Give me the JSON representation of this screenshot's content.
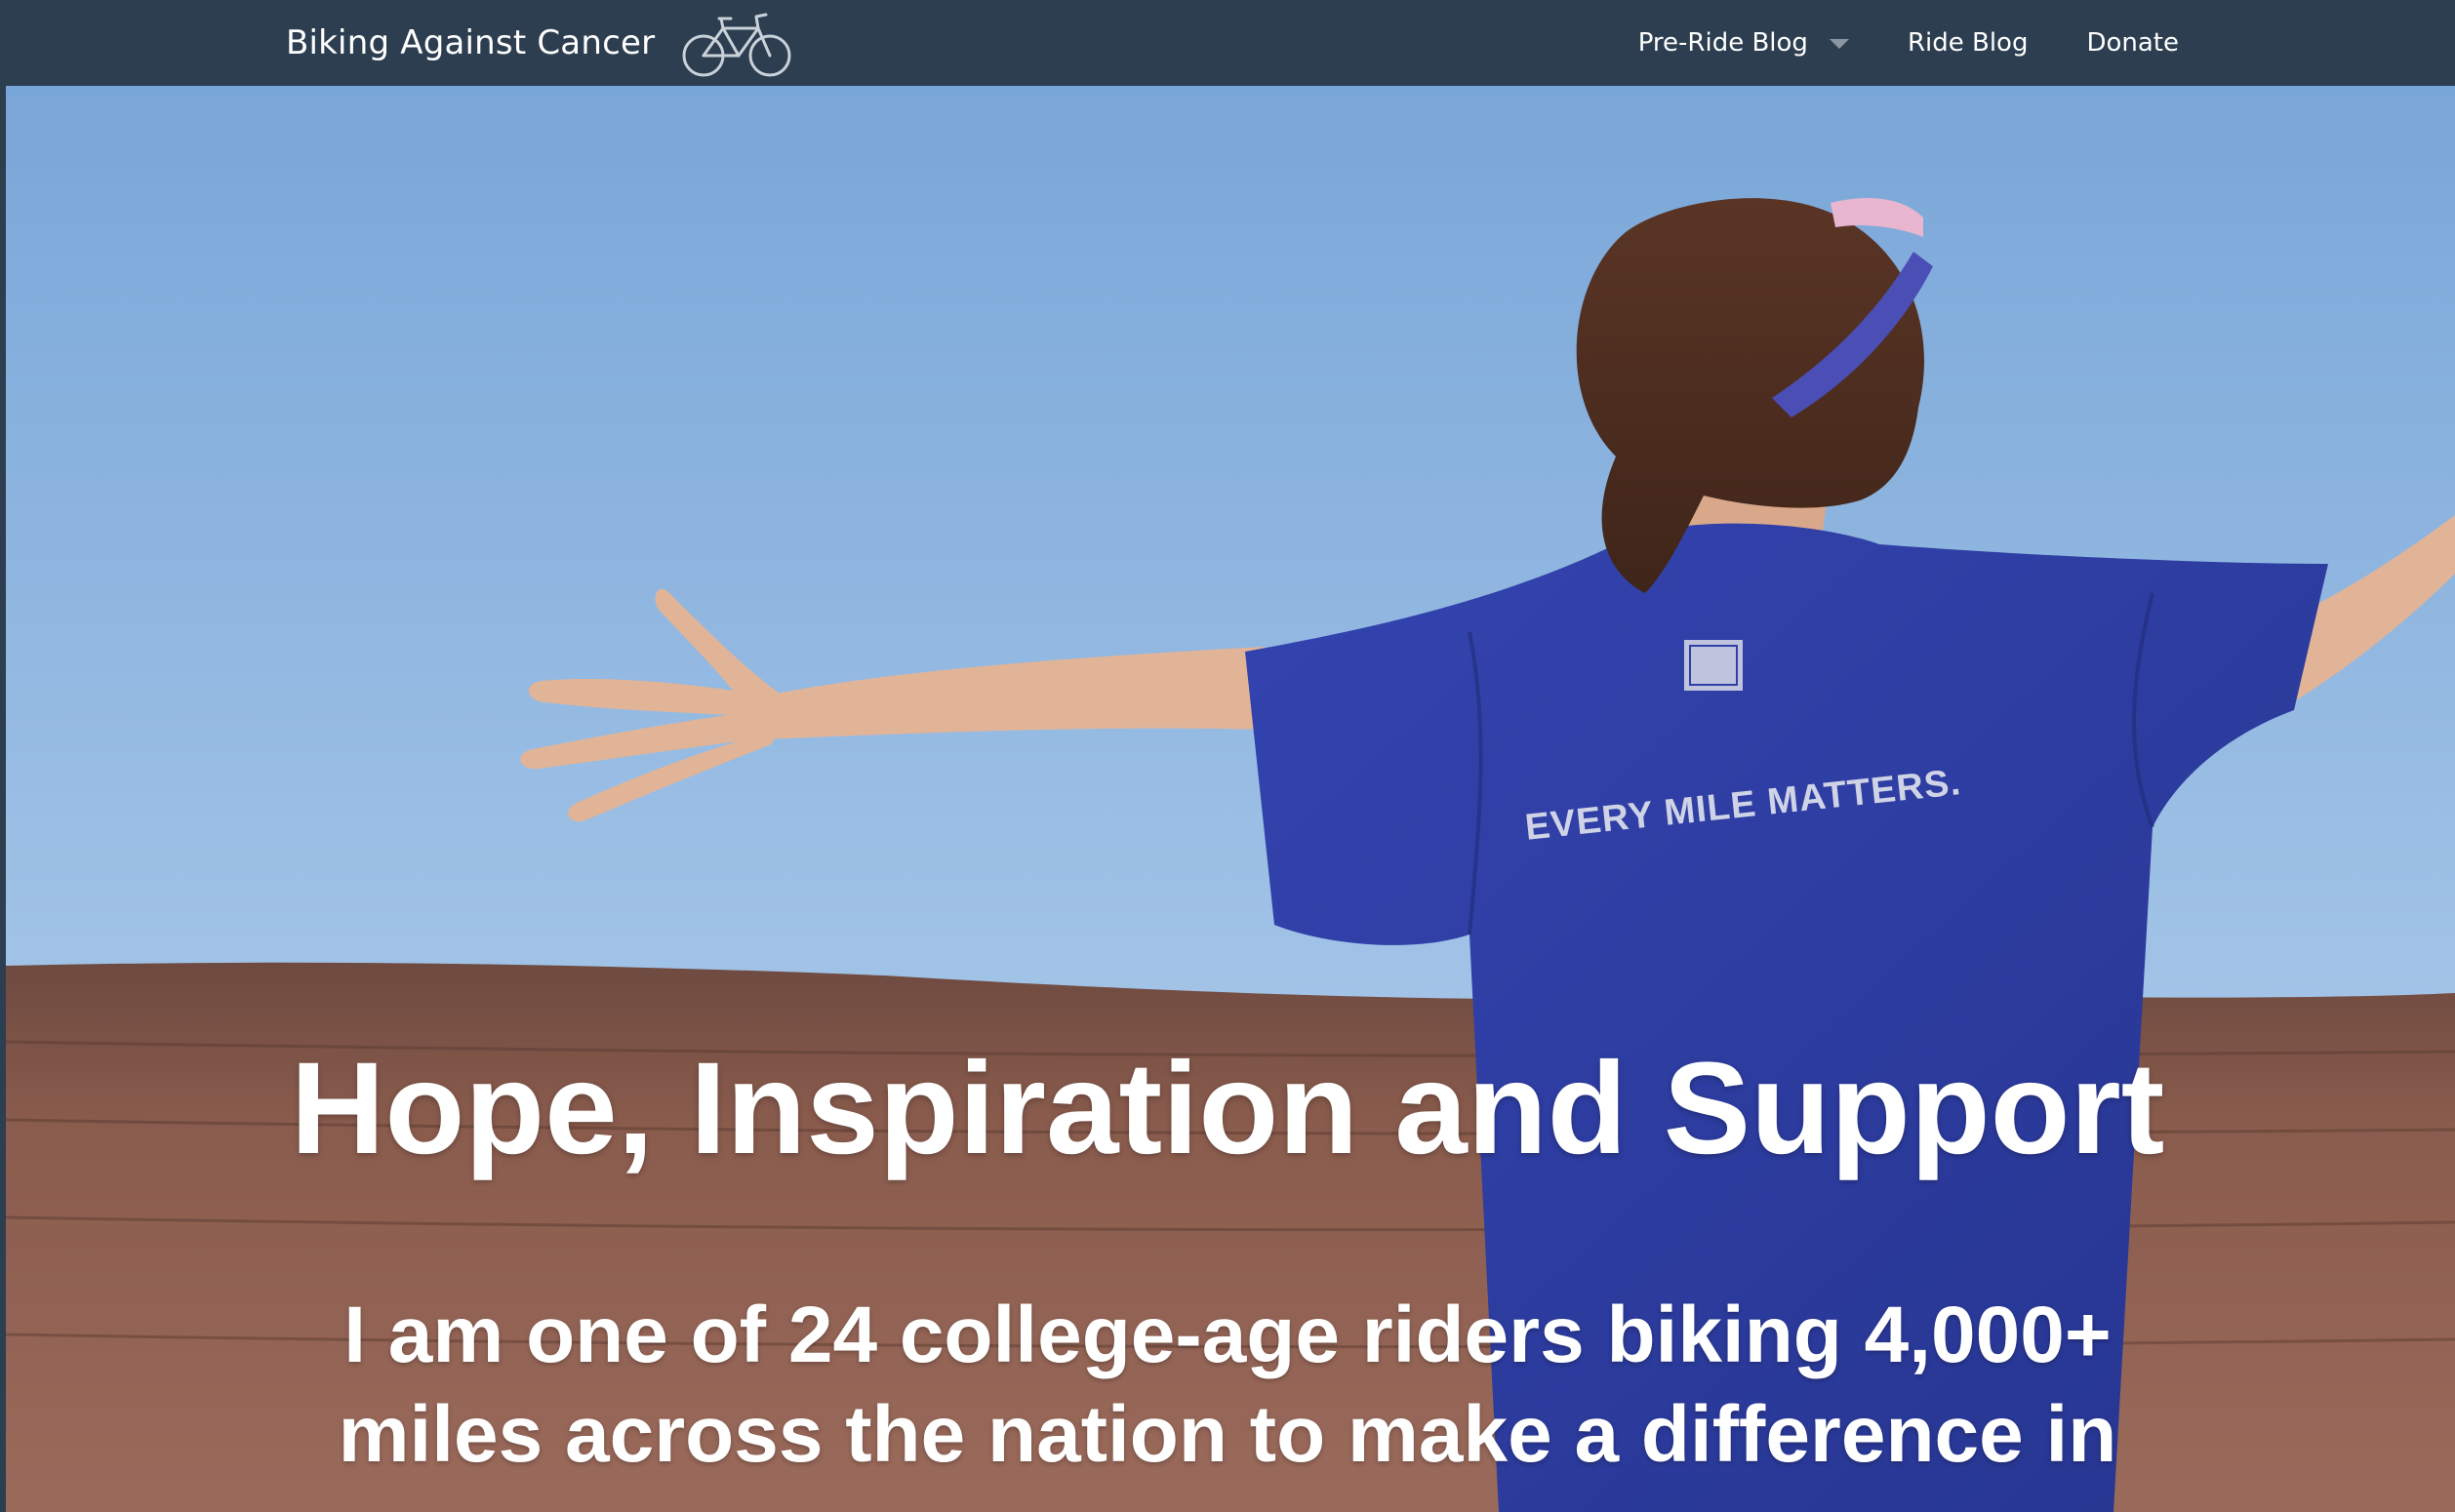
{
  "nav": {
    "brand_name": "Biking Against Cancer",
    "brand_icon": "bicycle-icon",
    "items": [
      {
        "label": "Pre-Ride Blog",
        "has_dropdown": true
      },
      {
        "label": "Ride Blog"
      },
      {
        "label": "Donate"
      }
    ]
  },
  "hero": {
    "shirt_text": "EVERY MILE MATTERS.",
    "headline": "Hope, Inspiration and Support",
    "subheadline": "I am one of 24 college-age riders biking 4,000+ miles across the nation to make a difference in"
  },
  "colors": {
    "navbar_bg": "#2c3e50",
    "nav_text": "#ffffff",
    "sky_top": "#79a6d8",
    "sky_bottom": "#b5d1ee",
    "mesa": "#8a5a4c",
    "shirt": "#2f3fa6"
  }
}
